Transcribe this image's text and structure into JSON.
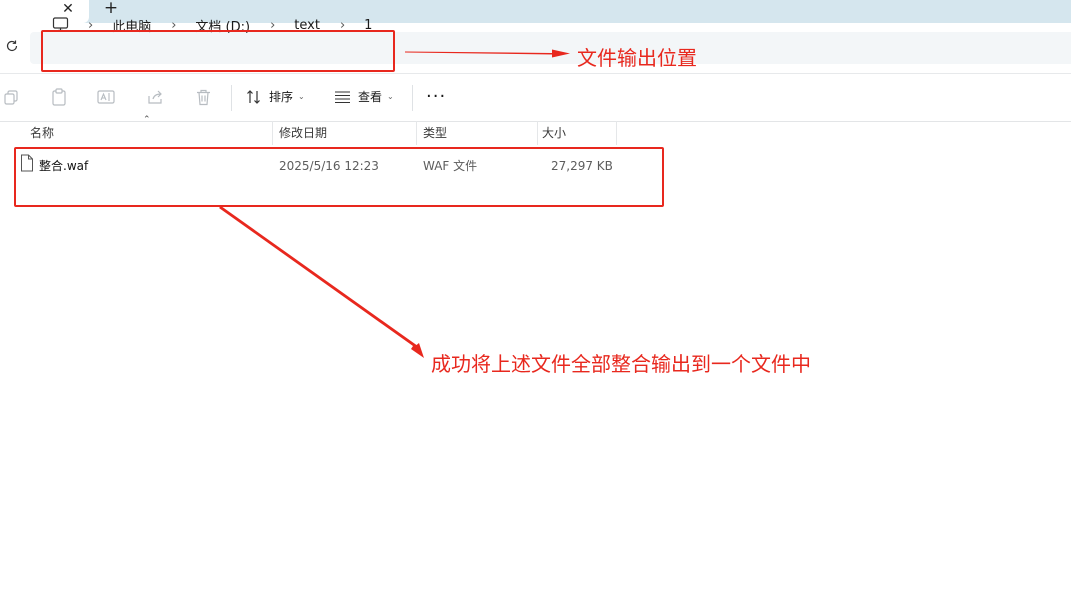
{
  "tabs": {
    "close_glyph": "✕",
    "add_glyph": "+"
  },
  "address": {
    "refresh_icon": "refresh-icon",
    "root_icon": "monitor-icon",
    "separator": "›",
    "crumbs": [
      "此电脑",
      "文档 (D:)",
      "text",
      "1"
    ]
  },
  "toolbar": {
    "icons": [
      "copy-icon",
      "paste-icon",
      "rename-icon",
      "share-icon",
      "delete-icon"
    ],
    "sort_label": "排序",
    "view_label": "查看",
    "more_label": "···"
  },
  "columns": {
    "name": "名称",
    "modified": "修改日期",
    "type": "类型",
    "size": "大小"
  },
  "files": [
    {
      "name": "整合.waf",
      "modified": "2025/5/16 12:23",
      "type": "WAF 文件",
      "size": "27,297 KB"
    }
  ],
  "annotations": {
    "output_location": "文件输出位置",
    "merge_success": "成功将上述文件全部整合输出到一个文件中",
    "color": "#e8281e"
  }
}
